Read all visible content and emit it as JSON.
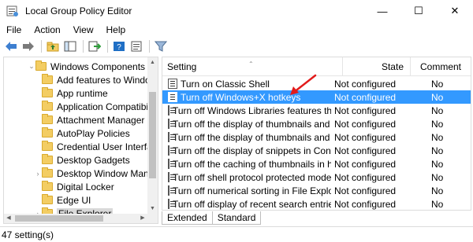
{
  "window": {
    "title": "Local Group Policy Editor",
    "controls": {
      "minimize": "—",
      "maximize": "☐",
      "close": "✕"
    }
  },
  "menu": [
    {
      "label": "File"
    },
    {
      "label": "Action"
    },
    {
      "label": "View"
    },
    {
      "label": "Help"
    }
  ],
  "toolbar": {
    "buttons": [
      {
        "icon": "back-arrow-icon"
      },
      {
        "icon": "forward-arrow-icon"
      },
      {
        "icon": "up-folder-icon"
      },
      {
        "icon": "show-hide-tree-icon"
      },
      {
        "icon": "export-list-icon"
      },
      {
        "icon": "help-icon"
      },
      {
        "icon": "properties-icon"
      },
      {
        "icon": "filter-icon"
      }
    ]
  },
  "tree": {
    "items": [
      {
        "label": "Windows Components",
        "expanded": true,
        "selected": false
      },
      {
        "label": "Add features to Window",
        "expanded": false,
        "selected": false
      },
      {
        "label": "App runtime",
        "expanded": false,
        "selected": false
      },
      {
        "label": "Application Compatibilit",
        "expanded": false,
        "selected": false
      },
      {
        "label": "Attachment Manager",
        "expanded": false,
        "selected": false
      },
      {
        "label": "AutoPlay Policies",
        "expanded": false,
        "selected": false
      },
      {
        "label": "Credential User Interface",
        "expanded": false,
        "selected": false
      },
      {
        "label": "Desktop Gadgets",
        "expanded": false,
        "selected": false
      },
      {
        "label": "Desktop Window Manag",
        "expanded": false,
        "selected": false
      },
      {
        "label": "Digital Locker",
        "expanded": false,
        "selected": false
      },
      {
        "label": "Edge UI",
        "expanded": false,
        "selected": false
      },
      {
        "label": "File Explorer",
        "expanded": false,
        "selected": true
      }
    ]
  },
  "list": {
    "columns": [
      "Setting",
      "State",
      "Comment"
    ],
    "rows": [
      {
        "setting": "Turn on Classic Shell",
        "state": "Not configured",
        "comment": "No",
        "selected": false
      },
      {
        "setting": "Turn off Windows+X hotkeys",
        "state": "Not configured",
        "comment": "No",
        "selected": true
      },
      {
        "setting": "Turn off Windows Libraries features that r...",
        "state": "Not configured",
        "comment": "No",
        "selected": false
      },
      {
        "setting": "Turn off the display of thumbnails and onl...",
        "state": "Not configured",
        "comment": "No",
        "selected": false
      },
      {
        "setting": "Turn off the display of thumbnails and onl...",
        "state": "Not configured",
        "comment": "No",
        "selected": false
      },
      {
        "setting": "Turn off the display of snippets in Content...",
        "state": "Not configured",
        "comment": "No",
        "selected": false
      },
      {
        "setting": "Turn off the caching of thumbnails in hid...",
        "state": "Not configured",
        "comment": "No",
        "selected": false
      },
      {
        "setting": "Turn off shell protocol protected mode",
        "state": "Not configured",
        "comment": "No",
        "selected": false
      },
      {
        "setting": "Turn off numerical sorting in File Explorer",
        "state": "Not configured",
        "comment": "No",
        "selected": false
      },
      {
        "setting": "Turn off display of recent search entries in...",
        "state": "Not configured",
        "comment": "No",
        "selected": false
      }
    ]
  },
  "tabs": [
    {
      "label": "Extended",
      "active": false
    },
    {
      "label": "Standard",
      "active": true
    }
  ],
  "status": {
    "text": "47 setting(s)"
  },
  "colors": {
    "selection": "#3399ff",
    "annotation_arrow": "#e21b1b",
    "folder": "#f3cd63"
  }
}
